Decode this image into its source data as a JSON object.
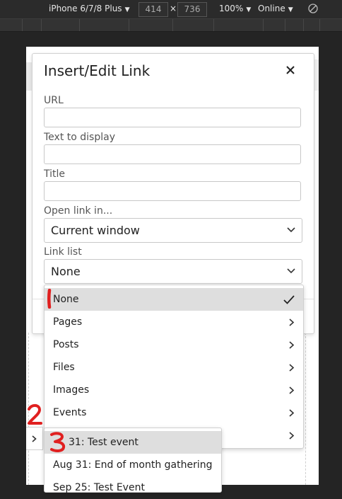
{
  "devtools": {
    "device": "iPhone 6/7/8 Plus",
    "width": "414",
    "x": "×",
    "height": "736",
    "zoom": "100%",
    "network": "Online"
  },
  "dialog": {
    "title": "Insert/Edit Link",
    "url_label": "URL",
    "url_value": "",
    "text_label": "Text to display",
    "text_value": "",
    "title_label": "Title",
    "title_value": "",
    "open_label": "Open link in...",
    "open_value": "Current window",
    "linklist_label": "Link list",
    "linklist_value": "None"
  },
  "menu": {
    "items": [
      "None",
      "Pages",
      "Posts",
      "Files",
      "Images",
      "Events"
    ],
    "selected": "None"
  },
  "submenu": {
    "items": [
      "31: Test event",
      "Aug 31: End of month gathering",
      "Sep 25: Test Event"
    ]
  },
  "annotations": [
    "1",
    "2",
    "3"
  ],
  "colors": {
    "annotation": "#e02020",
    "highlight": "#dedede"
  }
}
